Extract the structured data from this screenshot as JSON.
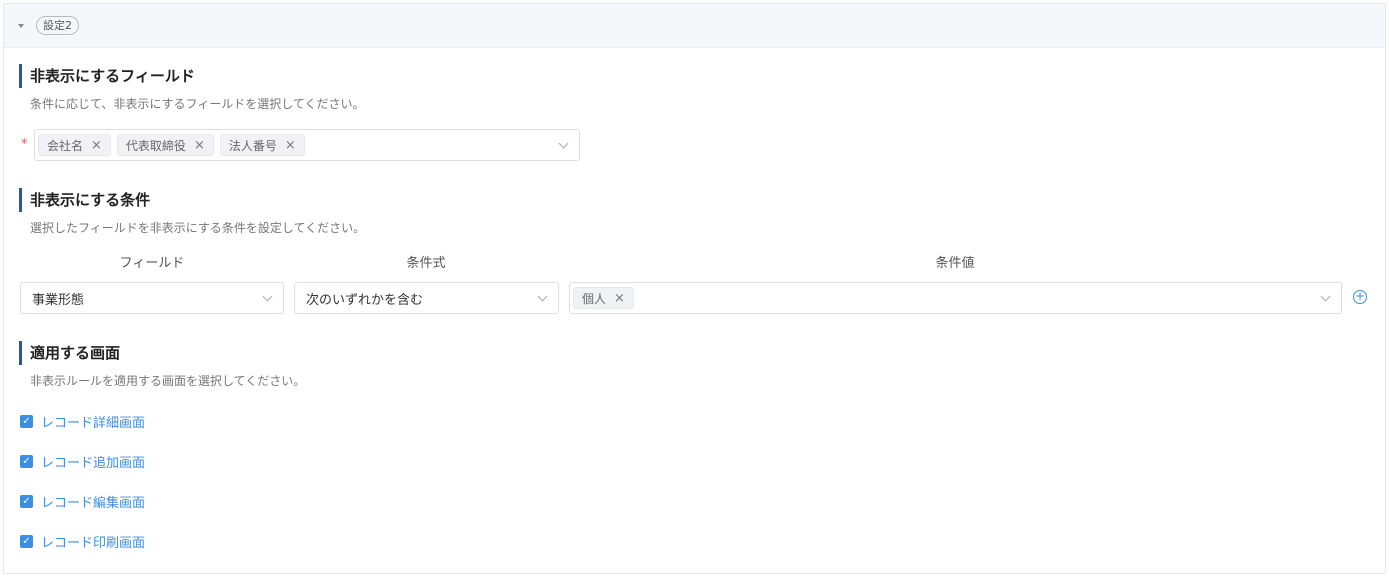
{
  "header": {
    "badge": "設定2"
  },
  "hide_fields": {
    "title": "非表示にするフィールド",
    "description": "条件に応じて、非表示にするフィールドを選択してください。",
    "required_mark": "*",
    "selected": [
      "会社名",
      "代表取締役",
      "法人番号"
    ]
  },
  "hide_condition": {
    "title": "非表示にする条件",
    "description": "選択したフィールドを非表示にする条件を設定してください。",
    "columns": {
      "field": "フィールド",
      "operator": "条件式",
      "value": "条件値"
    },
    "row": {
      "field": "事業形態",
      "operator": "次のいずれかを含む",
      "values": [
        "個人"
      ]
    }
  },
  "apply_screens": {
    "title": "適用する画面",
    "description": "非表示ルールを適用する画面を選択してください。",
    "options": [
      {
        "label": "レコード詳細画面",
        "checked": true
      },
      {
        "label": "レコード追加画面",
        "checked": true
      },
      {
        "label": "レコード編集画面",
        "checked": true
      },
      {
        "label": "レコード印刷画面",
        "checked": true
      }
    ]
  },
  "icons": {
    "remove": "×",
    "add": "+",
    "check": "✓"
  },
  "colors": {
    "accent": "#3a8ee6",
    "section_bar": "#2b5a8a",
    "required": "#e65a5a"
  }
}
